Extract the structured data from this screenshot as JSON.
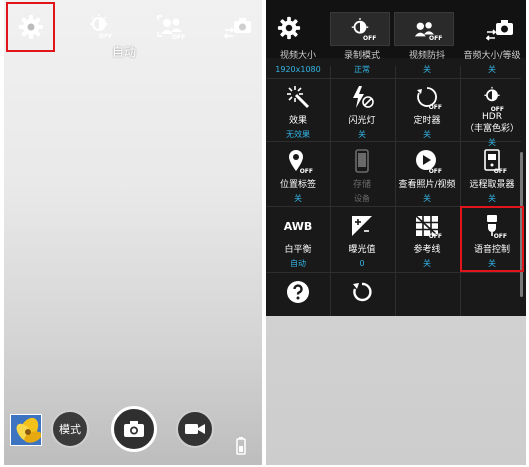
{
  "left": {
    "status_auto": "自动",
    "mode_label": "模式",
    "off_tag": "OFF",
    "icons": [
      "gear-icon",
      "hdr-off-icon",
      "face-detect-off-icon",
      "switch-camera-icon",
      "camera-icon",
      "video-camera-icon",
      "battery-icon",
      "gallery-thumbnail"
    ]
  },
  "right": {
    "top_row_partial": [
      {
        "label": "视频大小",
        "value": "1920x1080"
      },
      {
        "label": "录制模式",
        "value": "正常"
      },
      {
        "label": "视频防抖",
        "value": "关"
      },
      {
        "label": "音频大小/等级",
        "value": "关"
      }
    ],
    "rows": [
      [
        {
          "label": "效果",
          "value": "无效果",
          "icon": "effects-icon"
        },
        {
          "label": "闪光灯",
          "value": "关",
          "icon": "flash-off-icon"
        },
        {
          "label": "定时器",
          "value": "关",
          "icon": "timer-off-icon"
        },
        {
          "label": "HDR\n（丰富色彩）",
          "label_line1": "HDR",
          "label_line2": "（丰富色彩）",
          "value": "关",
          "icon": "hdr-off-icon"
        }
      ],
      [
        {
          "label": "位置标签",
          "value": "关",
          "icon": "location-off-icon"
        },
        {
          "label": "存储",
          "value": "设备",
          "icon": "storage-icon",
          "disabled": true
        },
        {
          "label": "查看照片/视频",
          "value": "关",
          "icon": "review-off-icon"
        },
        {
          "label": "远程取景器",
          "value": "关",
          "icon": "remote-viewfinder-off-icon"
        }
      ],
      [
        {
          "label": "白平衡",
          "value": "自动",
          "icon": "awb-icon",
          "icon_text": "AWB"
        },
        {
          "label": "曝光值",
          "value": "0",
          "icon": "exposure-icon"
        },
        {
          "label": "参考线",
          "value": "关",
          "icon": "guidelines-off-icon"
        },
        {
          "label": "语音控制",
          "value": "关",
          "icon": "voice-control-off-icon"
        }
      ]
    ],
    "bottom": [
      "help-icon",
      "reset-icon"
    ],
    "off_tag": "OFF"
  },
  "colors": {
    "accent": "#33b5e5",
    "highlight": "#e0141b",
    "menu_bg": "#191919"
  }
}
